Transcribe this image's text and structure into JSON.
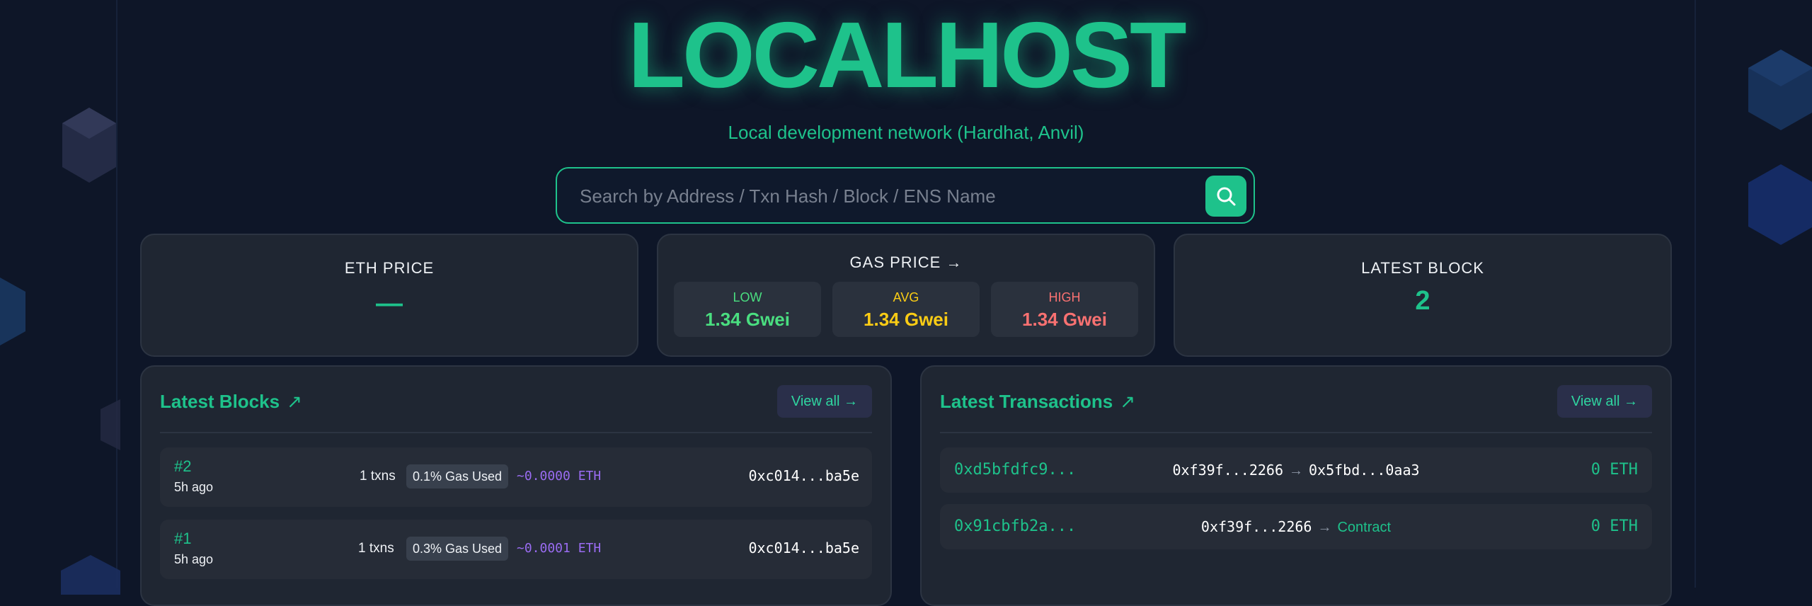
{
  "header": {
    "title": "LOCALHOST",
    "subtitle": "Local development network (Hardhat, Anvil)"
  },
  "search": {
    "placeholder": "Search by Address / Txn Hash / Block / ENS Name",
    "button_icon": "search-icon"
  },
  "stats": {
    "eth_price": {
      "label": "ETH PRICE",
      "value": "—"
    },
    "gas_price": {
      "label": "GAS PRICE →",
      "low": {
        "label": "LOW",
        "value": "1.34 Gwei"
      },
      "avg": {
        "label": "AVG",
        "value": "1.34 Gwei"
      },
      "high": {
        "label": "HIGH",
        "value": "1.34 Gwei"
      }
    },
    "latest_block": {
      "label": "LATEST BLOCK",
      "value": "2"
    }
  },
  "blocks": {
    "title": "Latest Blocks",
    "title_arrow": "↗",
    "view_all": "View all →",
    "rows": [
      {
        "number": "#2",
        "ago": "5h ago",
        "txns": "1 txns",
        "gas": "0.1% Gas Used",
        "reward": "~0.0000 ETH",
        "miner": "0xc014...ba5e"
      },
      {
        "number": "#1",
        "ago": "5h ago",
        "txns": "1 txns",
        "gas": "0.3% Gas Used",
        "reward": "~0.0001 ETH",
        "miner": "0xc014...ba5e"
      }
    ]
  },
  "transactions": {
    "title": "Latest Transactions",
    "title_arrow": "↗",
    "view_all": "View all →",
    "rows": [
      {
        "hash": "0xd5bfdfc9...",
        "from": "0xf39f...2266",
        "arrow": "→",
        "to": "0x5fbd...0aa3",
        "value": "0 ETH"
      },
      {
        "hash": "0x91cbfb2a...",
        "from": "0xf39f...2266",
        "arrow": "→",
        "to": "Contract",
        "value": "0 ETH"
      }
    ]
  },
  "colors": {
    "accent": "#1ec28b",
    "background": "#0e1628",
    "card": "#1f2632",
    "low": "#4ade80",
    "avg": "#facc15",
    "high": "#f87171",
    "reward": "#9a6cf2"
  }
}
